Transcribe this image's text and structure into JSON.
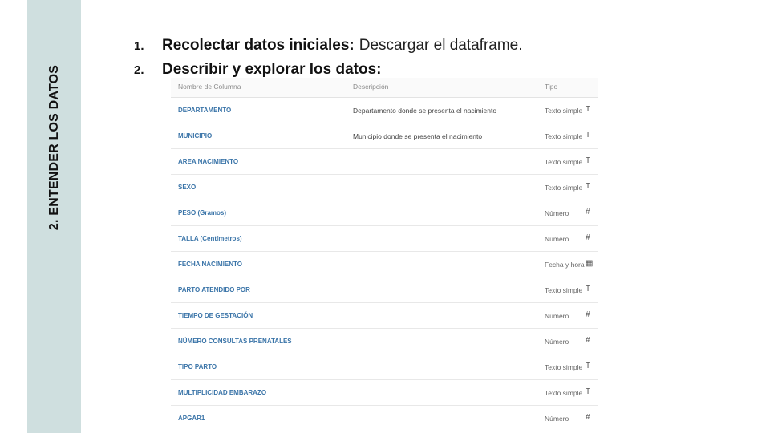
{
  "sidebar": {
    "title": "2. ENTENDER LOS DATOS"
  },
  "steps": [
    {
      "number": "1.",
      "heading": "Recolectar datos iniciales:",
      "text": "Descargar el dataframe."
    },
    {
      "number": "2.",
      "heading": "Describir y explorar los datos:",
      "text": ""
    }
  ],
  "table": {
    "headers": {
      "name": "Nombre de Columna",
      "description": "Descripción",
      "type": "Tipo"
    },
    "rows": [
      {
        "name": "DEPARTAMENTO",
        "description": "Departamento donde se presenta el nacimiento",
        "type": "Texto simple",
        "icon": "T"
      },
      {
        "name": "MUNICIPIO",
        "description": "Municipio donde se presenta el nacimiento",
        "type": "Texto simple",
        "icon": "T"
      },
      {
        "name": "AREA NACIMIENTO",
        "description": "",
        "type": "Texto simple",
        "icon": "T"
      },
      {
        "name": "SEXO",
        "description": "",
        "type": "Texto simple",
        "icon": "T"
      },
      {
        "name": "PESO (Gramos)",
        "description": "",
        "type": "Número",
        "icon": "#"
      },
      {
        "name": "TALLA (Centímetros)",
        "description": "",
        "type": "Número",
        "icon": "#"
      },
      {
        "name": "FECHA NACIMIENTO",
        "description": "",
        "type": "Fecha y hora",
        "icon": "▦"
      },
      {
        "name": "PARTO ATENDIDO POR",
        "description": "",
        "type": "Texto simple",
        "icon": "T"
      },
      {
        "name": "TIEMPO DE GESTACIÓN",
        "description": "",
        "type": "Número",
        "icon": "#"
      },
      {
        "name": "NÚMERO CONSULTAS PRENATALES",
        "description": "",
        "type": "Número",
        "icon": "#"
      },
      {
        "name": "TIPO PARTO",
        "description": "",
        "type": "Texto simple",
        "icon": "T"
      },
      {
        "name": "MULTIPLICIDAD EMBARAZO",
        "description": "",
        "type": "Texto simple",
        "icon": "T"
      },
      {
        "name": "APGAR1",
        "description": "",
        "type": "Número",
        "icon": "#"
      }
    ]
  }
}
